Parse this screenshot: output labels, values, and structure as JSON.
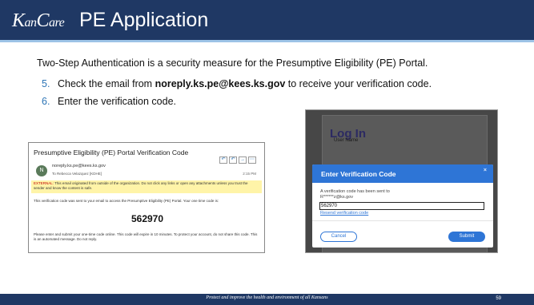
{
  "header": {
    "logo": "KanCare",
    "title": "PE Application"
  },
  "intro": "Two-Step Authentication is a security measure for the Presumptive Eligibility (PE) Portal.",
  "steps": [
    {
      "num": "5.",
      "pre": "Check the email from ",
      "bold": "noreply.ks.pe@kees.ks.gov",
      "post": " to receive your verification code."
    },
    {
      "num": "6.",
      "pre": "Enter the verification code.",
      "bold": "",
      "post": ""
    }
  ],
  "email": {
    "subject": "Presumptive Eligibility (PE) Portal Verification Code",
    "avatar": "N",
    "from": "noreply.ks.pe@kees.ks.gov",
    "to": "To  Rebecca Velazquez [KDHE]",
    "time": "2:15 PM",
    "warning_label": "EXTERNAL:",
    "warning": " This email originated from outside of the organization. Do not click any links or open any attachments unless you trust the sender and know the content is safe.",
    "body": "This verification code was sent to your email to access the Presumptive Eligibility (PE) Portal. Your one time code is:",
    "code": "562970",
    "footer": "Please enter and submit your one-time code online. This code will expire in 10 minutes. To protect your account, do not share this code. This is an automated message. Do not reply."
  },
  "login": {
    "title": "Log In",
    "user_label": "User Name",
    "modal_title": "Enter Verification Code",
    "close": "×",
    "message_line1": "A verification code has been sent to",
    "message_line2": "R******z@ks.gov",
    "input_value": "562970",
    "resend": "Resend verification code",
    "cancel": "Cancel",
    "submit": "Submit"
  },
  "footer": {
    "text": "Protect and improve the health and environment of all Kansans",
    "page": "59"
  }
}
